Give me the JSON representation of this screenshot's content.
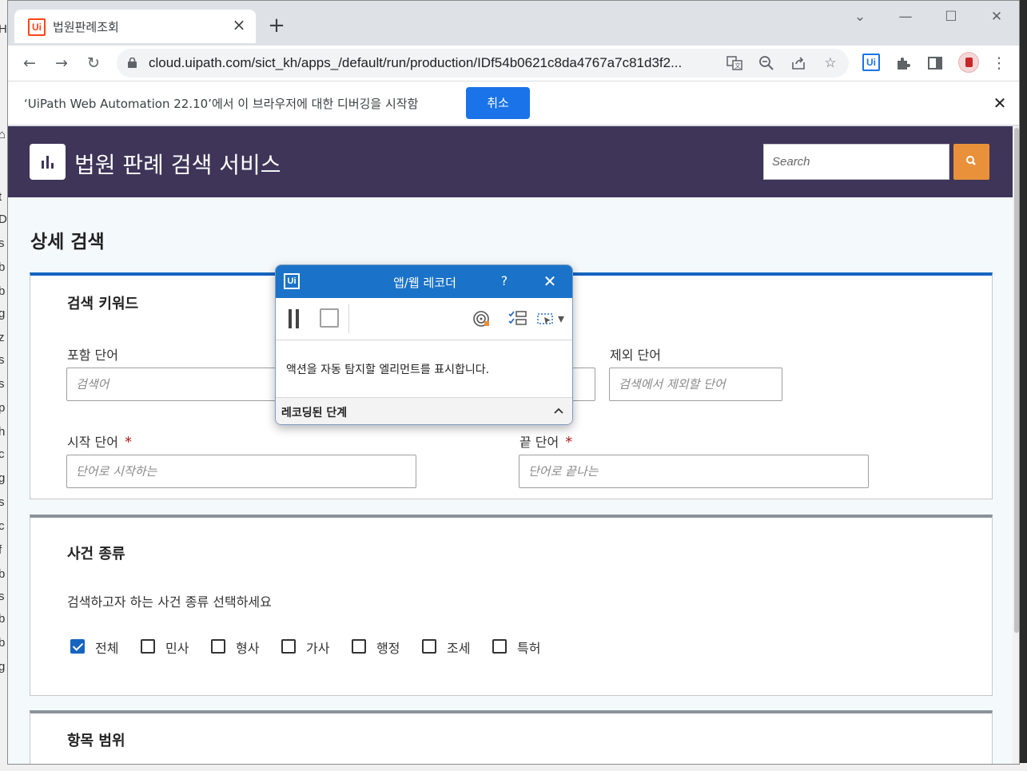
{
  "background": {
    "left_fragments": [
      "H",
      "⌂",
      "t",
      "D",
      "s",
      "b",
      "b",
      "g",
      "z",
      "s",
      "s",
      "p",
      "h",
      "c",
      "g",
      "s",
      "c",
      "f",
      "b",
      "s",
      "b",
      "b",
      "g"
    ]
  },
  "browser": {
    "tab": {
      "favicon": "Ui",
      "title": "법원판례조회",
      "close_icon": "×"
    },
    "new_tab_icon": "+",
    "window_controls": {
      "minimize": "—",
      "maximize": "☐",
      "close": "✕",
      "tab_search": "⌄"
    },
    "toolbar": {
      "back_icon": "←",
      "forward_icon": "→",
      "reload_icon": "↻",
      "url": "cloud.uipath.com/sict_kh/apps_/default/run/production/IDf54b0621c8da4767a7c81d3f2...",
      "translate_icon": "translate-icon",
      "zoom_icon": "zoom-icon",
      "share_icon": "share-icon",
      "bookmark_icon": "☆",
      "ext_uipath": "Ui",
      "extensions_icon": "puzzle-icon",
      "side_panel_icon": "side-panel-icon",
      "menu_icon": "⋮"
    },
    "infobar": {
      "message": "‘UiPath Web Automation 22.10’에서 이 브라우저에 대한 디버깅을 시작함",
      "cancel_label": "취소",
      "close_icon": "✕"
    }
  },
  "app": {
    "title": "법원 판례 검색 서비스",
    "search": {
      "placeholder": "Search"
    },
    "colors": {
      "header_bg": "#3e3559",
      "search_btn": "#e8913a",
      "accent": "#1565c0"
    }
  },
  "main": {
    "heading": "상세 검색",
    "keywords": {
      "title": "검색 키워드",
      "include_label": "포함 단어",
      "include_placeholder": "검색어",
      "exclude_label": "제외 단어",
      "exclude_placeholder": "검색에서 제외할 단어",
      "start_label": "시작 단어",
      "start_placeholder": "단어로 시작하는",
      "end_label": "끝 단어",
      "end_placeholder": "단어로 끝나는",
      "required_mark": "*"
    },
    "case_type": {
      "title": "사건 종류",
      "instruction": "검색하고자 하는 사건 종류 선택하세요",
      "options": [
        {
          "label": "전체",
          "checked": true
        },
        {
          "label": "민사",
          "checked": false
        },
        {
          "label": "형사",
          "checked": false
        },
        {
          "label": "가사",
          "checked": false
        },
        {
          "label": "행정",
          "checked": false
        },
        {
          "label": "조세",
          "checked": false
        },
        {
          "label": "특허",
          "checked": false
        }
      ]
    },
    "range": {
      "title": "항목 범위"
    }
  },
  "recorder": {
    "logo": "Ui",
    "title": "앱/웹 레코더",
    "help": "?",
    "close": "✕",
    "message": "액션을 자동 탐지할 엘리먼트를 표시합니다.",
    "steps_label": "레코딩된 단계",
    "dropdown_icon": "▾"
  }
}
